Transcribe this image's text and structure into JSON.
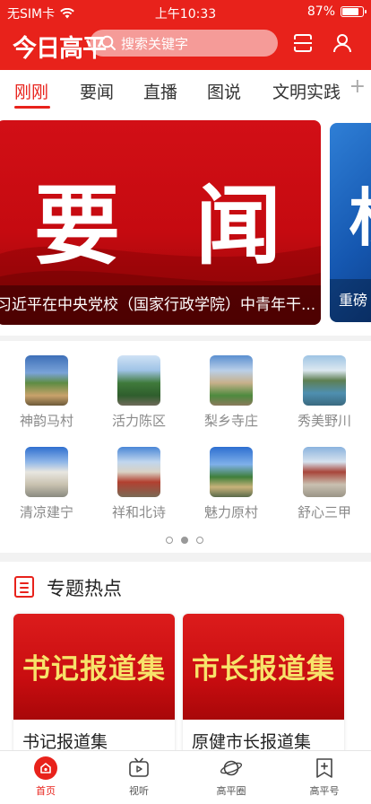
{
  "status_bar": {
    "carrier": "无SIM卡",
    "time": "上午10:33",
    "battery": "87%",
    "battery_level": 0.87
  },
  "header": {
    "logo": "今日高平",
    "search_placeholder": "搜索关键字"
  },
  "tabs": [
    {
      "label": "刚刚",
      "active": true
    },
    {
      "label": "要闻",
      "active": false
    },
    {
      "label": "直播",
      "active": false
    },
    {
      "label": "图说",
      "active": false
    },
    {
      "label": "文明实践",
      "active": false
    }
  ],
  "banners": [
    {
      "big_text_1": "要",
      "big_text_2": "闻",
      "caption": "习近平在中央党校（国家行政学院）中青年干..."
    },
    {
      "big_text": "权",
      "caption": "重磅"
    }
  ],
  "villages": [
    {
      "label": "神韵马村"
    },
    {
      "label": "活力陈区"
    },
    {
      "label": "梨乡寺庄"
    },
    {
      "label": "秀美野川"
    },
    {
      "label": "清凉建宁"
    },
    {
      "label": "祥和北诗"
    },
    {
      "label": "魅力原村"
    },
    {
      "label": "舒心三甲"
    }
  ],
  "pagination": {
    "pages": 3,
    "current": 2
  },
  "topics": {
    "title": "专题热点",
    "cards": [
      {
        "image_text": "书记报道集",
        "title": "书记报道集"
      },
      {
        "image_text": "市长报道集",
        "title": "原健市长报道集"
      }
    ]
  },
  "bottom_nav": [
    {
      "label": "首页",
      "icon": "home-icon",
      "active": true
    },
    {
      "label": "视听",
      "icon": "tv-icon",
      "active": false
    },
    {
      "label": "高平圈",
      "icon": "planet-icon",
      "active": false
    },
    {
      "label": "高平号",
      "icon": "bookmark-plus-icon",
      "active": false
    }
  ],
  "colors": {
    "brand_red": "#e8221b",
    "gold_text": "#f7e36a"
  }
}
